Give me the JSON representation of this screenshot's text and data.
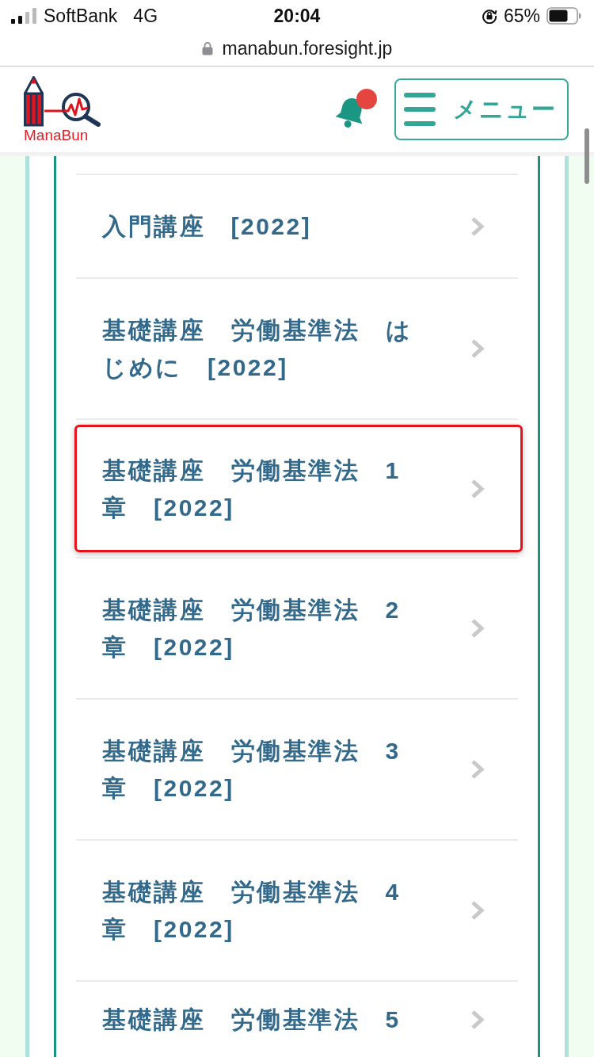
{
  "status_bar": {
    "carrier": "SoftBank",
    "network": "4G",
    "time": "20:04",
    "battery": "65%"
  },
  "address_bar": {
    "url": "manabun.foresight.jp"
  },
  "header": {
    "logo_text": "ManaBun",
    "notifications_unread": true,
    "menu_label": "メニュー"
  },
  "course_list": [
    {
      "title": "入門講座　[2022]",
      "highlighted": false
    },
    {
      "title": "基礎講座　労働基準法　はじめに　[2022]",
      "highlighted": false
    },
    {
      "title": "基礎講座　労働基準法　1章　[2022]",
      "highlighted": true
    },
    {
      "title": "基礎講座　労働基準法　2章　[2022]",
      "highlighted": false
    },
    {
      "title": "基礎講座　労働基準法　3章　[2022]",
      "highlighted": false
    },
    {
      "title": "基礎講座　労働基準法　4章　[2022]",
      "highlighted": false
    },
    {
      "title": "基礎講座　労働基準法　5",
      "highlighted": false
    }
  ]
}
